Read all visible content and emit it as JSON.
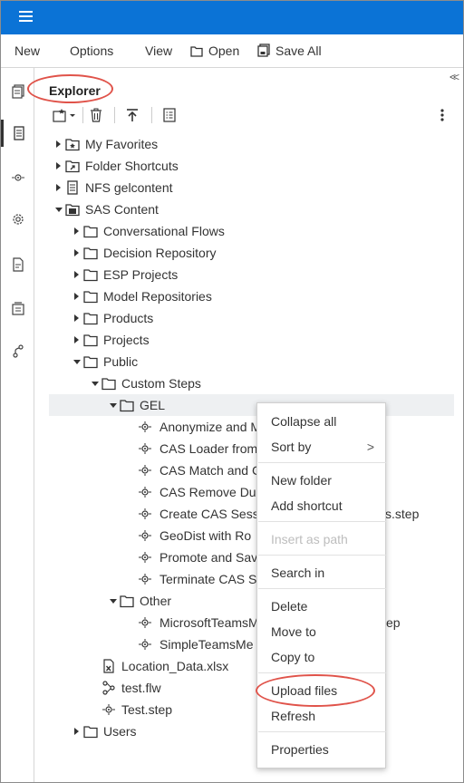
{
  "menubar": {
    "new_label": "New",
    "options_label": "Options",
    "view_label": "View",
    "open_label": "Open",
    "save_all_label": "Save All"
  },
  "panel": {
    "title": "Explorer",
    "collapse_glyph": "<<"
  },
  "tree": {
    "my_favorites": "My Favorites",
    "folder_shortcuts": "Folder Shortcuts",
    "nfs_gelcontent": "NFS gelcontent",
    "sas_content": "SAS Content",
    "conversational_flows": "Conversational Flows",
    "decision_repository": "Decision Repository",
    "esp_projects": "ESP Projects",
    "model_repositories": "Model Repositories",
    "products": "Products",
    "projects": "Projects",
    "public": "Public",
    "custom_steps": "Custom Steps",
    "gel": "GEL",
    "gel_steps": [
      "Anonymize and M",
      "CAS Loader from",
      "CAS Match and C",
      "CAS Remove Du",
      "Create CAS Sess",
      "GeoDist with Ro",
      "Promote and Sav",
      "Terminate CAS S"
    ],
    "create_cas_suffix": "s.step",
    "other": "Other",
    "other_steps": [
      "MicrosoftTeamsM",
      "SimpleTeamsMe"
    ],
    "ms_teams_suffix": "ep",
    "location_data": "Location_Data.xlsx",
    "test_flw": "test.flw",
    "test_step": "Test.step",
    "users": "Users"
  },
  "context_menu": {
    "collapse_all": "Collapse all",
    "sort_by": "Sort by",
    "sort_by_chevron": ">",
    "new_folder": "New folder",
    "add_shortcut": "Add shortcut",
    "insert_as_path": "Insert as path",
    "search_in": "Search in",
    "delete": "Delete",
    "move_to": "Move to",
    "copy_to": "Copy to",
    "upload_files": "Upload files",
    "refresh": "Refresh",
    "properties": "Properties"
  },
  "colors": {
    "topbar": "#0b73d6",
    "annotation_ring": "#e0534a",
    "disabled_text": "#bdbdbd"
  }
}
